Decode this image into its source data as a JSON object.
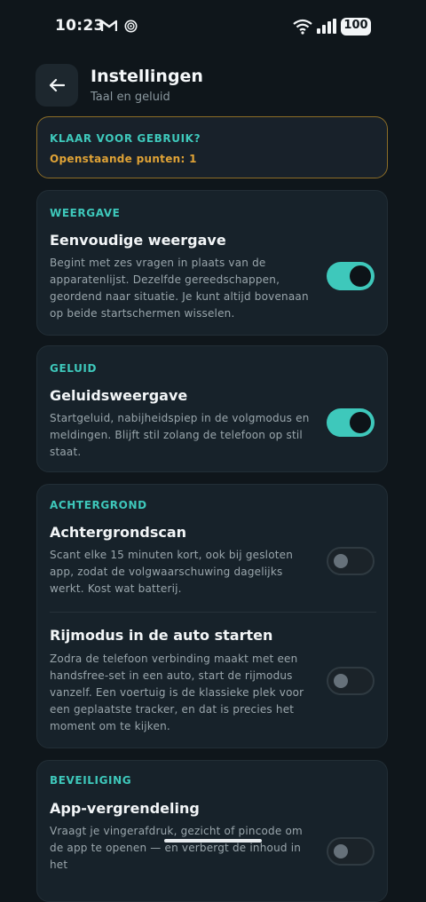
{
  "status_bar": {
    "time": "10:23",
    "battery": "100",
    "icons": [
      "gmail-icon",
      "app-notification-icon",
      "wifi-icon",
      "signal-icon",
      "battery-icon"
    ]
  },
  "header": {
    "title": "Instellingen",
    "subtitle": "Taal en geluid",
    "back_icon": "arrow-left-icon"
  },
  "ready_card": {
    "title": "KLAAR VOOR GEBRUIK?",
    "text": "Openstaande punten: 1"
  },
  "sections": [
    {
      "label": "WEERGAVE",
      "items": [
        {
          "title": "Eenvoudige weergave",
          "description": "Begint met zes vragen in plaats van de apparatenlijst. Dezelfde gereedschappen, geordend naar situatie. Je kunt altijd bovenaan op beide startschermen wisselen.",
          "enabled": true
        }
      ]
    },
    {
      "label": "GELUID",
      "items": [
        {
          "title": "Geluidsweergave",
          "description": "Startgeluid, nabijheidspiep in de volgmodus en meldingen. Blijft stil zolang de telefoon op stil staat.",
          "enabled": true
        }
      ]
    },
    {
      "label": "ACHTERGROND",
      "items": [
        {
          "title": "Achtergrondscan",
          "description": "Scant elke 15 minuten kort, ook bij gesloten app, zodat de volgwaarschuwing dagelijks werkt. Kost wat batterij.",
          "enabled": false
        },
        {
          "title": "Rijmodus in de auto starten",
          "description": "Zodra de telefoon verbinding maakt met een handsfree-set in een auto, start de rijmodus vanzelf. Een voertuig is de klassieke plek voor een geplaatste tracker, en dat is precies het moment om te kijken.",
          "enabled": false
        }
      ]
    },
    {
      "label": "BEVEILIGING",
      "items": [
        {
          "title": "App-vergrendeling",
          "description": "Vraagt je vingerafdruk, gezicht of pincode om de app te openen — en verbergt de inhoud in het",
          "enabled": false
        }
      ]
    }
  ],
  "colors": {
    "background": "#0f161b",
    "card": "#17222a",
    "accent": "#3ec8bb",
    "warning": "#e0a336"
  }
}
